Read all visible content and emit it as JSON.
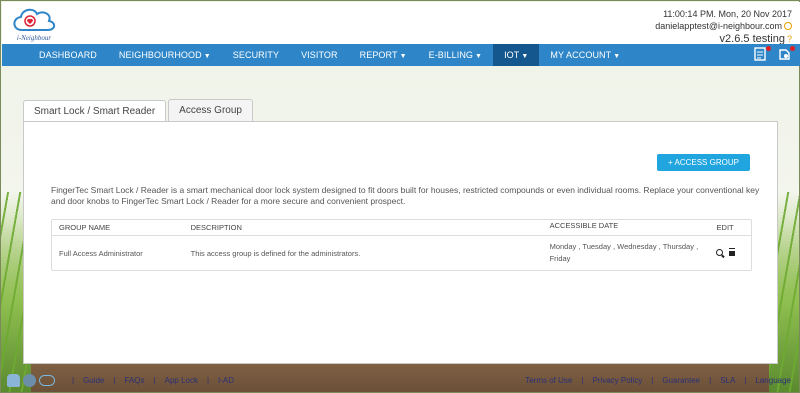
{
  "header": {
    "brand_name": "i-Neighbour",
    "datetime": "11:00:14 PM. Mon, 20 Nov 2017",
    "user_email": "danielapptest@i-neighbour.com",
    "version": "v2.6.5 testing"
  },
  "nav": {
    "items": [
      {
        "label": "DASHBOARD",
        "caret": false
      },
      {
        "label": "NEIGHBOURHOOD",
        "caret": true
      },
      {
        "label": "SECURITY",
        "caret": false
      },
      {
        "label": "VISITOR",
        "caret": false
      },
      {
        "label": "REPORT",
        "caret": true
      },
      {
        "label": "E-BILLING",
        "caret": true
      },
      {
        "label": "IOT",
        "caret": true,
        "active": true
      },
      {
        "label": "MY ACCOUNT",
        "caret": true
      }
    ],
    "icons": [
      "notes-icon",
      "notification-icon"
    ]
  },
  "tabs": [
    {
      "label": "Smart Lock / Smart Reader",
      "active": true
    },
    {
      "label": "Access Group",
      "active": false
    }
  ],
  "panel": {
    "add_button": "+ ACCESS GROUP",
    "description": "FingerTec Smart Lock / Reader is a smart mechanical door lock system designed to fit doors built for houses, restricted compounds or even individual rooms. Replace your conventional key and door knobs to FingerTec Smart Lock / Reader for a more secure and convenient prospect.",
    "table": {
      "headers": [
        "GROUP NAME",
        "DESCRIPTION",
        "ACCESSIBLE DATE",
        "EDIT"
      ],
      "rows": [
        {
          "group_name": "Full Access Administrator",
          "description": "This access group is defined for the administrators.",
          "accessible_date": "Monday , Tuesday , Wednesday , Thursday , Friday"
        }
      ]
    }
  },
  "footer": {
    "left_links": [
      "Guide",
      "FAQs",
      "App Lock",
      "I-AD"
    ],
    "right_links": [
      "Terms of Use",
      "Privacy Policy",
      "Guarantee",
      "SLA",
      "Language"
    ],
    "separator": "|"
  },
  "colors": {
    "nav_bg": "#2e86c8",
    "nav_active": "#14578f",
    "button": "#21a5df",
    "footer_link": "#2b2f78"
  }
}
